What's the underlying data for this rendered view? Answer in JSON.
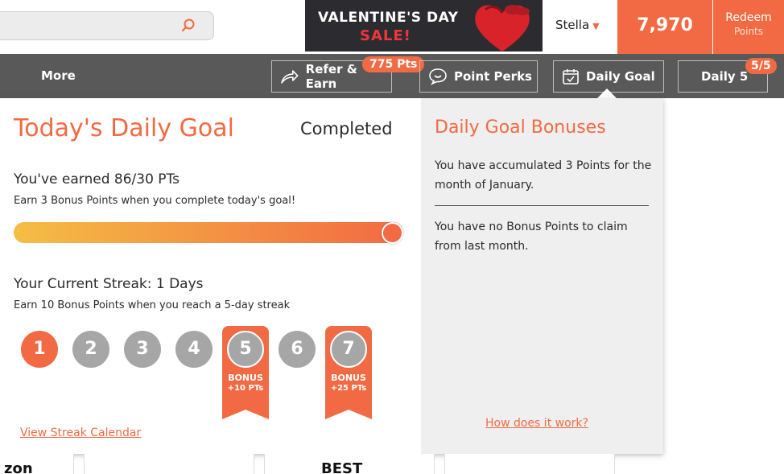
{
  "header": {
    "search_placeholder": "",
    "banner_line1": "VALENTINE'S DAY",
    "banner_line2": "SALE!",
    "user_name": "Stella",
    "points_total": "7,970",
    "redeem_label": "Redeem",
    "redeem_sub": "Points"
  },
  "nav": {
    "more": "More",
    "refer_earn": "Refer & Earn",
    "refer_badge": "775 Pts",
    "point_perks": "Point Perks",
    "daily_goal": "Daily Goal",
    "daily5": "Daily 5",
    "daily5_badge": "5/5"
  },
  "goal": {
    "title": "Today's Daily Goal",
    "status": "Completed",
    "earned": "You've earned 86/30 PTs",
    "earn_sub": "Earn 3 Bonus Points when you complete today's goal!",
    "progress_fraction": 1.0,
    "streak": "Your Current Streak: 1 Days",
    "streak_sub": "Earn 10 Bonus Points when you reach a 5-day streak",
    "days": [
      "1",
      "2",
      "3",
      "4",
      "5",
      "6",
      "7"
    ],
    "active_days": 1,
    "bonus_label": "BONUS",
    "bonus5": "+10 PTs",
    "bonus7": "+25 PTs",
    "calendar_link": "View Streak Calendar"
  },
  "bonuses": {
    "title": "Daily Goal Bonuses",
    "accumulated": "You have accumulated 3 Points for the month of January.",
    "no_bonus": "You have no Bonus Points to claim from last month.",
    "how_link": "How does it work?"
  },
  "bottom": {
    "peek1": "zon",
    "peek2": "BEST"
  },
  "colors": {
    "accent": "#f26a43",
    "nav_bg": "#595959",
    "gray_day": "#a6a6a6",
    "panel_right": "#efefef"
  }
}
